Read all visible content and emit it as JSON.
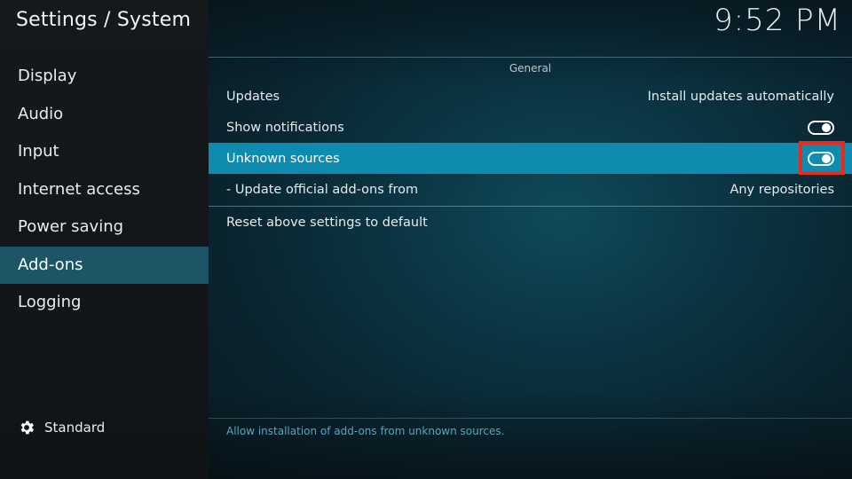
{
  "header": {
    "title": "Settings / System",
    "clock": "9:52 PM"
  },
  "sidebar": {
    "items": [
      {
        "label": "Display",
        "selected": false
      },
      {
        "label": "Audio",
        "selected": false
      },
      {
        "label": "Input",
        "selected": false
      },
      {
        "label": "Internet access",
        "selected": false
      },
      {
        "label": "Power saving",
        "selected": false
      },
      {
        "label": "Add-ons",
        "selected": true
      },
      {
        "label": "Logging",
        "selected": false
      }
    ],
    "level": {
      "icon": "gear-icon",
      "label": "Standard"
    }
  },
  "main": {
    "group_title": "General",
    "settings": [
      {
        "label": "Updates",
        "value": "Install updates automatically"
      },
      {
        "label": "Show notifications",
        "toggle": true
      },
      {
        "label": "Unknown sources",
        "toggle": true,
        "selected": true
      },
      {
        "label": "- Update official add-ons from",
        "value": "Any repositories"
      }
    ],
    "reset_label": "Reset above settings to default",
    "help_text": "Allow installation of add-ons from unknown sources."
  },
  "colors": {
    "selected_row": "#0f8bb0",
    "selected_nav": "#1b5566",
    "highlight_box": "#ea2a1a",
    "help_text": "#4fa9c9"
  }
}
